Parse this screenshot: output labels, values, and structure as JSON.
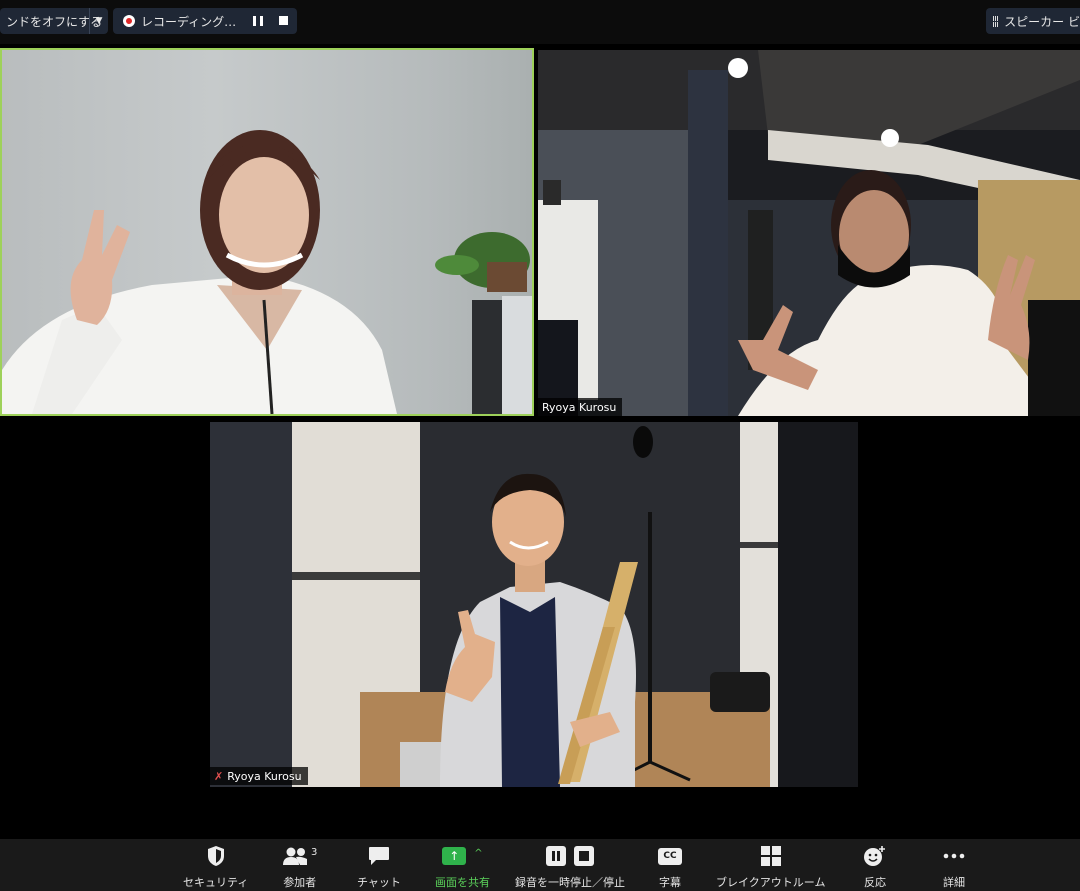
{
  "top_bar": {
    "sound_pill_label": "ンドをオフにする",
    "recording_label": "レコーディング…",
    "view_label": "スピーカー ビ"
  },
  "tiles": {
    "top_right": {
      "name": "Ryoya Kurosu"
    },
    "bottom": {
      "name": "Ryoya Kurosu"
    }
  },
  "toolbar": {
    "security": "セキュリティ",
    "participants": "参加者",
    "participants_count": "3",
    "chat": "チャット",
    "share": "画面を共有",
    "recording_control": "録音を一時停止／停止",
    "captions": "字幕",
    "captions_badge": "CC",
    "breakout": "ブレイクアウトルーム",
    "reactions": "反応",
    "more": "詳細"
  },
  "colors": {
    "active_speaker_border": "#9ed15a",
    "share_green": "#2fb24b",
    "record_red": "#e02828"
  }
}
